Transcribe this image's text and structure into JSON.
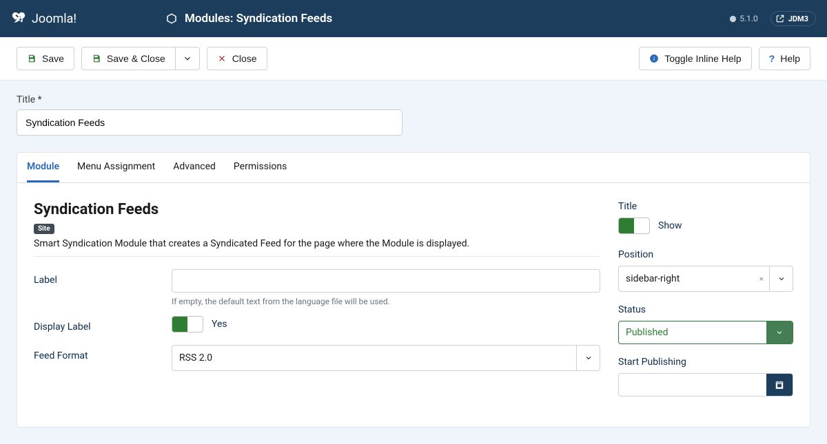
{
  "header": {
    "brand": "Joomla!",
    "page_title": "Modules: Syndication Feeds",
    "version": "5.1.0",
    "user": "JDM3"
  },
  "toolbar": {
    "save": "Save",
    "save_close": "Save & Close",
    "close": "Close",
    "toggle_help": "Toggle Inline Help",
    "help": "Help"
  },
  "form": {
    "title_label": "Title *",
    "title_value": "Syndication Feeds"
  },
  "tabs": [
    "Module",
    "Menu Assignment",
    "Advanced",
    "Permissions"
  ],
  "module": {
    "heading": "Syndication Feeds",
    "site_badge": "Site",
    "description": "Smart Syndication Module that creates a Syndicated Feed for the page where the Module is displayed.",
    "label_field": "Label",
    "label_value": "",
    "label_hint": "If empty, the default text from the language file will be used.",
    "display_label_field": "Display Label",
    "display_label_value": "Yes",
    "feed_format_field": "Feed Format",
    "feed_format_value": "RSS 2.0"
  },
  "side": {
    "title_label": "Title",
    "title_value": "Show",
    "position_label": "Position",
    "position_value": "sidebar-right",
    "status_label": "Status",
    "status_value": "Published",
    "start_pub_label": "Start Publishing",
    "start_pub_value": ""
  }
}
